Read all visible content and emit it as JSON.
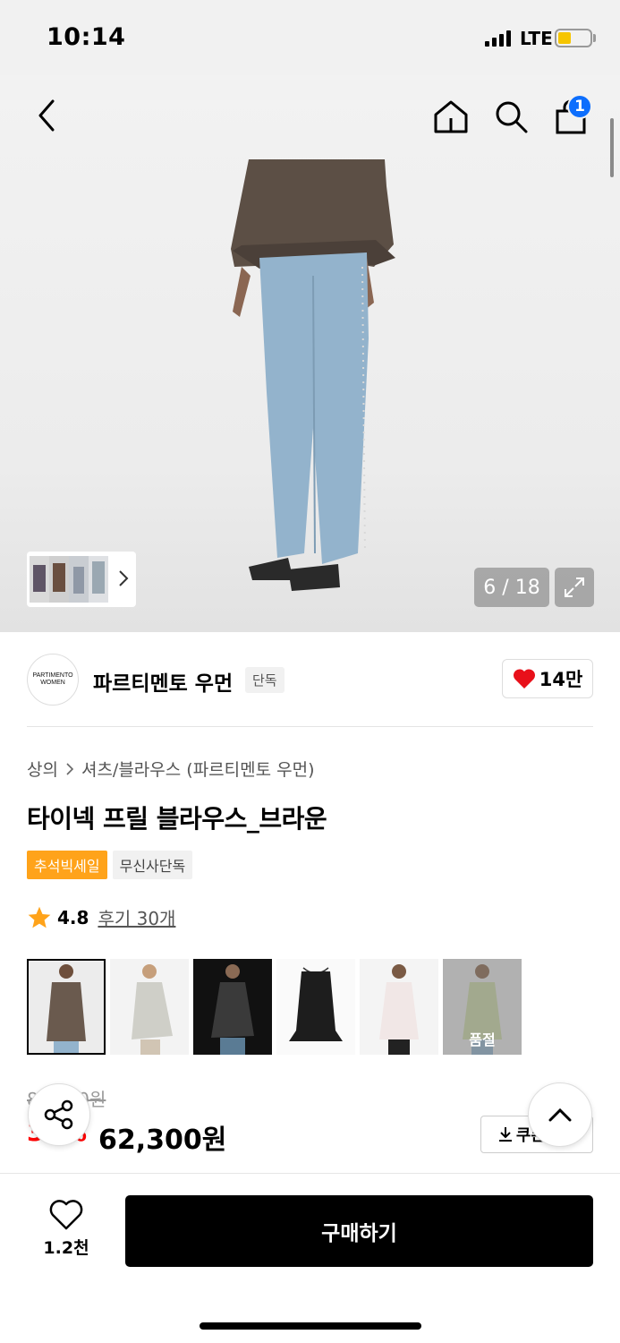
{
  "status_bar": {
    "time": "10:14",
    "network": "LTE"
  },
  "header": {
    "cart_count": "1"
  },
  "gallery": {
    "page_counter": "6 / 18"
  },
  "brand": {
    "logo_line1": "PARTIMENTO",
    "logo_line2": "WOMEN",
    "name": "파르티멘토 우먼",
    "tag": "단독",
    "likes": "14만"
  },
  "breadcrumb": {
    "category": "상의",
    "subcategory": "셔츠/블라우스 (파르티멘토 우먼)"
  },
  "product": {
    "title": "타이넥 프릴 블라우스_브라운",
    "badges": [
      "추석빅세일",
      "무신사단독"
    ],
    "rating": "4.8",
    "reviews": "후기 30개",
    "color_options": [
      {
        "color": "#6a5a4e",
        "sold_out": false
      },
      {
        "color": "#cfcfc8",
        "sold_out": false
      },
      {
        "color": "#3a3a3a",
        "sold_out": false
      },
      {
        "color": "#1d1d1d",
        "sold_out": false
      },
      {
        "color": "#f1e7e6",
        "sold_out": false
      },
      {
        "color": "#cdd9a8",
        "sold_out": true
      }
    ],
    "soldout_label": "품절",
    "original_price": "89,000원",
    "discount": "30%",
    "price": "62,300원",
    "coupon_label": "쿠폰받기"
  },
  "bottom": {
    "wish_count": "1.2천",
    "buy_label": "구매하기"
  },
  "colors": {
    "accent_blue": "#0d6efd",
    "sale_orange": "#ffa31a",
    "discount_red": "#ff0000",
    "heart_red": "#e8101a"
  }
}
